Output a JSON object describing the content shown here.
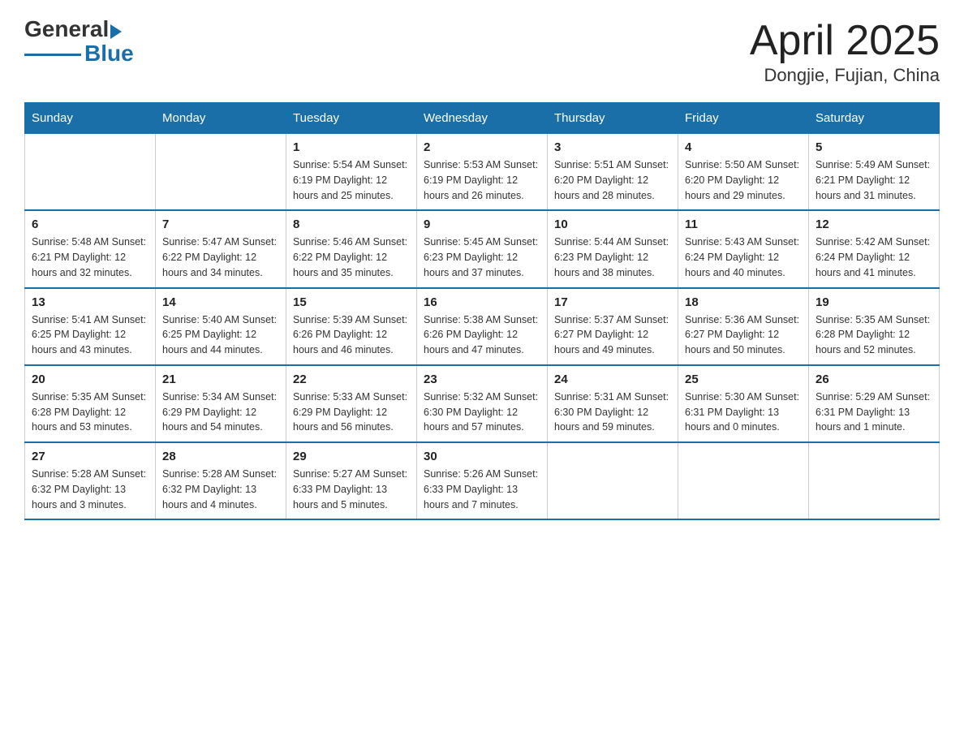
{
  "header": {
    "logo_general": "General",
    "logo_blue": "Blue",
    "title": "April 2025",
    "subtitle": "Dongjie, Fujian, China"
  },
  "days_of_week": [
    "Sunday",
    "Monday",
    "Tuesday",
    "Wednesday",
    "Thursday",
    "Friday",
    "Saturday"
  ],
  "weeks": [
    [
      {
        "day": "",
        "info": ""
      },
      {
        "day": "",
        "info": ""
      },
      {
        "day": "1",
        "info": "Sunrise: 5:54 AM\nSunset: 6:19 PM\nDaylight: 12 hours\nand 25 minutes."
      },
      {
        "day": "2",
        "info": "Sunrise: 5:53 AM\nSunset: 6:19 PM\nDaylight: 12 hours\nand 26 minutes."
      },
      {
        "day": "3",
        "info": "Sunrise: 5:51 AM\nSunset: 6:20 PM\nDaylight: 12 hours\nand 28 minutes."
      },
      {
        "day": "4",
        "info": "Sunrise: 5:50 AM\nSunset: 6:20 PM\nDaylight: 12 hours\nand 29 minutes."
      },
      {
        "day": "5",
        "info": "Sunrise: 5:49 AM\nSunset: 6:21 PM\nDaylight: 12 hours\nand 31 minutes."
      }
    ],
    [
      {
        "day": "6",
        "info": "Sunrise: 5:48 AM\nSunset: 6:21 PM\nDaylight: 12 hours\nand 32 minutes."
      },
      {
        "day": "7",
        "info": "Sunrise: 5:47 AM\nSunset: 6:22 PM\nDaylight: 12 hours\nand 34 minutes."
      },
      {
        "day": "8",
        "info": "Sunrise: 5:46 AM\nSunset: 6:22 PM\nDaylight: 12 hours\nand 35 minutes."
      },
      {
        "day": "9",
        "info": "Sunrise: 5:45 AM\nSunset: 6:23 PM\nDaylight: 12 hours\nand 37 minutes."
      },
      {
        "day": "10",
        "info": "Sunrise: 5:44 AM\nSunset: 6:23 PM\nDaylight: 12 hours\nand 38 minutes."
      },
      {
        "day": "11",
        "info": "Sunrise: 5:43 AM\nSunset: 6:24 PM\nDaylight: 12 hours\nand 40 minutes."
      },
      {
        "day": "12",
        "info": "Sunrise: 5:42 AM\nSunset: 6:24 PM\nDaylight: 12 hours\nand 41 minutes."
      }
    ],
    [
      {
        "day": "13",
        "info": "Sunrise: 5:41 AM\nSunset: 6:25 PM\nDaylight: 12 hours\nand 43 minutes."
      },
      {
        "day": "14",
        "info": "Sunrise: 5:40 AM\nSunset: 6:25 PM\nDaylight: 12 hours\nand 44 minutes."
      },
      {
        "day": "15",
        "info": "Sunrise: 5:39 AM\nSunset: 6:26 PM\nDaylight: 12 hours\nand 46 minutes."
      },
      {
        "day": "16",
        "info": "Sunrise: 5:38 AM\nSunset: 6:26 PM\nDaylight: 12 hours\nand 47 minutes."
      },
      {
        "day": "17",
        "info": "Sunrise: 5:37 AM\nSunset: 6:27 PM\nDaylight: 12 hours\nand 49 minutes."
      },
      {
        "day": "18",
        "info": "Sunrise: 5:36 AM\nSunset: 6:27 PM\nDaylight: 12 hours\nand 50 minutes."
      },
      {
        "day": "19",
        "info": "Sunrise: 5:35 AM\nSunset: 6:28 PM\nDaylight: 12 hours\nand 52 minutes."
      }
    ],
    [
      {
        "day": "20",
        "info": "Sunrise: 5:35 AM\nSunset: 6:28 PM\nDaylight: 12 hours\nand 53 minutes."
      },
      {
        "day": "21",
        "info": "Sunrise: 5:34 AM\nSunset: 6:29 PM\nDaylight: 12 hours\nand 54 minutes."
      },
      {
        "day": "22",
        "info": "Sunrise: 5:33 AM\nSunset: 6:29 PM\nDaylight: 12 hours\nand 56 minutes."
      },
      {
        "day": "23",
        "info": "Sunrise: 5:32 AM\nSunset: 6:30 PM\nDaylight: 12 hours\nand 57 minutes."
      },
      {
        "day": "24",
        "info": "Sunrise: 5:31 AM\nSunset: 6:30 PM\nDaylight: 12 hours\nand 59 minutes."
      },
      {
        "day": "25",
        "info": "Sunrise: 5:30 AM\nSunset: 6:31 PM\nDaylight: 13 hours\nand 0 minutes."
      },
      {
        "day": "26",
        "info": "Sunrise: 5:29 AM\nSunset: 6:31 PM\nDaylight: 13 hours\nand 1 minute."
      }
    ],
    [
      {
        "day": "27",
        "info": "Sunrise: 5:28 AM\nSunset: 6:32 PM\nDaylight: 13 hours\nand 3 minutes."
      },
      {
        "day": "28",
        "info": "Sunrise: 5:28 AM\nSunset: 6:32 PM\nDaylight: 13 hours\nand 4 minutes."
      },
      {
        "day": "29",
        "info": "Sunrise: 5:27 AM\nSunset: 6:33 PM\nDaylight: 13 hours\nand 5 minutes."
      },
      {
        "day": "30",
        "info": "Sunrise: 5:26 AM\nSunset: 6:33 PM\nDaylight: 13 hours\nand 7 minutes."
      },
      {
        "day": "",
        "info": ""
      },
      {
        "day": "",
        "info": ""
      },
      {
        "day": "",
        "info": ""
      }
    ]
  ]
}
